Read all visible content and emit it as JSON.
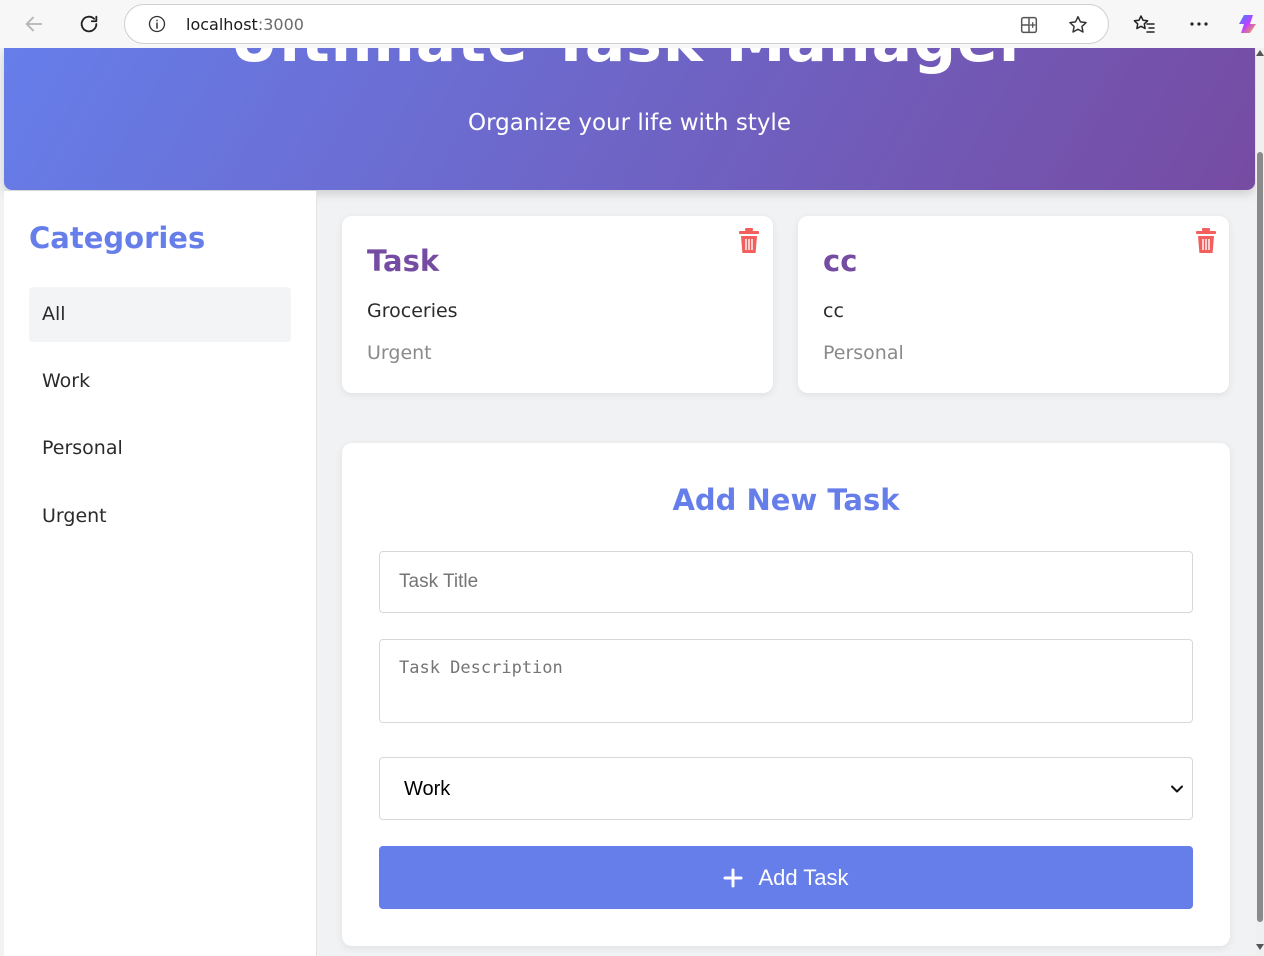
{
  "browser": {
    "url_host": "localhost",
    "url_port": ":3000"
  },
  "header": {
    "title": "Ultimate Task Manager",
    "subtitle": "Organize your life with style"
  },
  "sidebar": {
    "title": "Categories",
    "items": [
      {
        "label": "All",
        "active": true
      },
      {
        "label": "Work",
        "active": false
      },
      {
        "label": "Personal",
        "active": false
      },
      {
        "label": "Urgent",
        "active": false
      }
    ]
  },
  "tasks": [
    {
      "title": "Task",
      "description": "Groceries",
      "category": "Urgent"
    },
    {
      "title": "cc",
      "description": "cc",
      "category": "Personal"
    }
  ],
  "form": {
    "title": "Add New Task",
    "title_placeholder": "Task Title",
    "description_placeholder": "Task Description",
    "selected_category": "Work",
    "submit_label": "Add Task"
  },
  "colors": {
    "accent": "#667eea",
    "accent_dark": "#764ba2",
    "danger": "#f25f5c"
  },
  "icons": [
    "back-arrow-icon",
    "refresh-icon",
    "info-icon",
    "split-screen-icon",
    "star-icon",
    "favorites-icon",
    "more-icon",
    "copilot-icon",
    "trash-icon",
    "plus-icon",
    "chevron-down-icon"
  ]
}
